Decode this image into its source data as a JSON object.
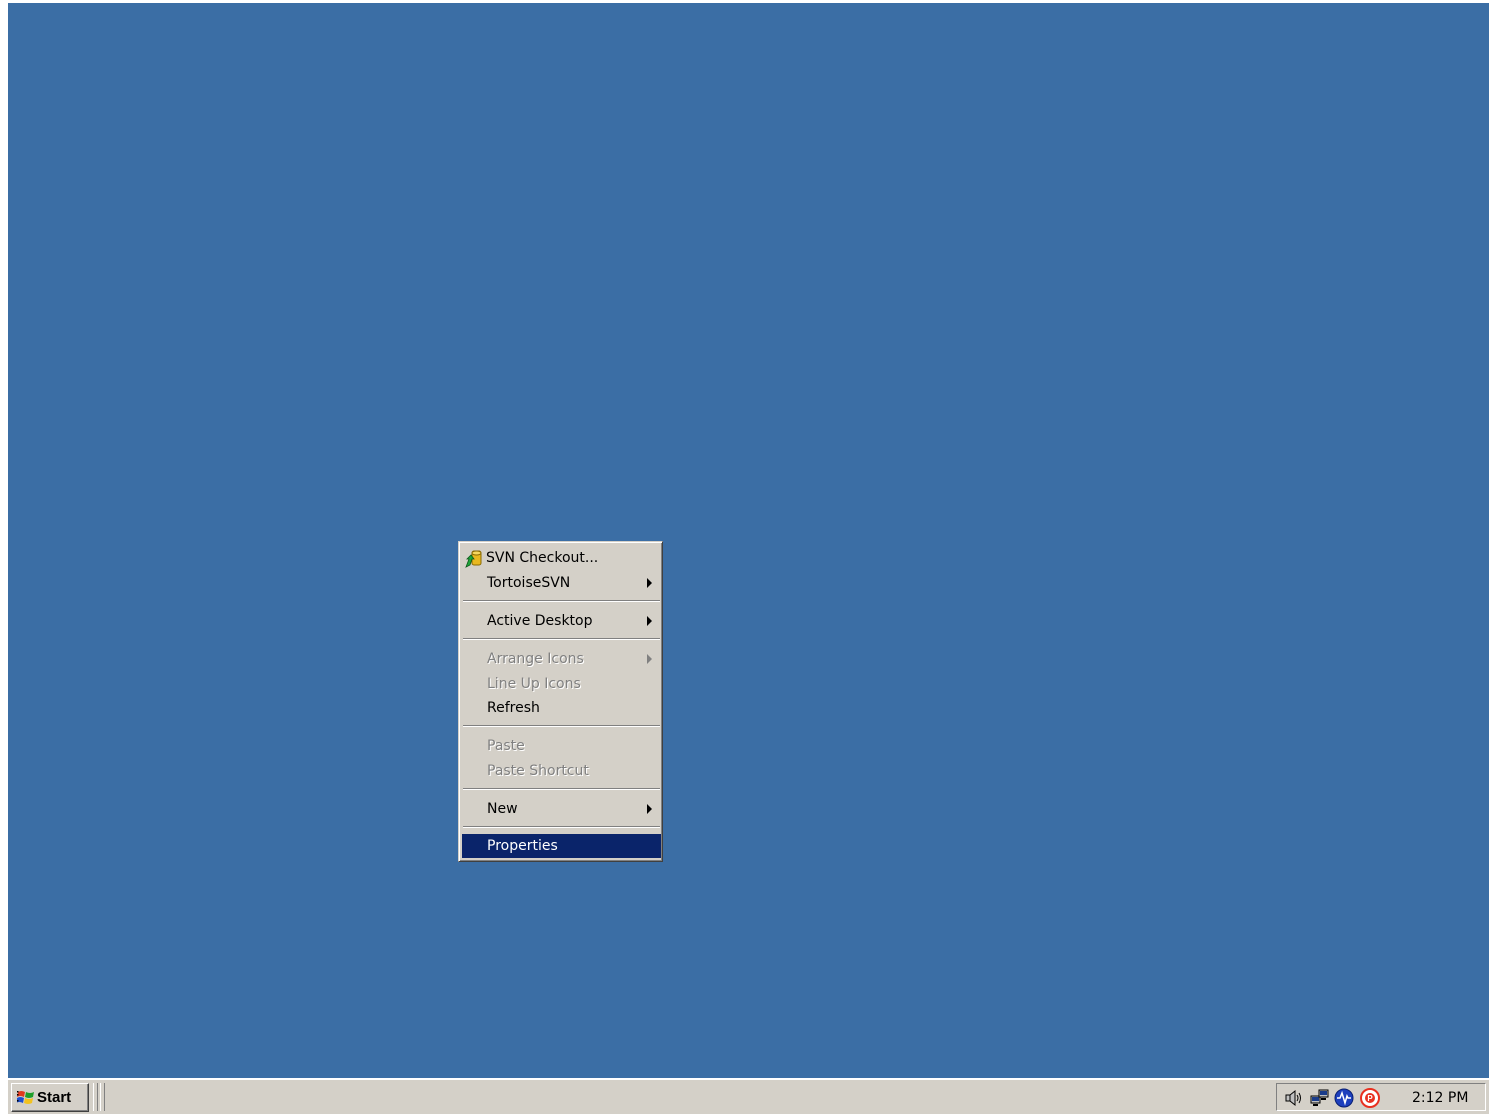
{
  "colors": {
    "desktop_background": "#3b6ea5",
    "menu_background": "#d4d0c8",
    "highlight": "#0a246a"
  },
  "context_menu": {
    "items": [
      {
        "label": "SVN Checkout...",
        "icon": "tortoisesvn-checkout-icon",
        "enabled": true
      },
      {
        "label": "TortoiseSVN",
        "submenu": true,
        "enabled": true
      },
      {
        "label": "Active Desktop",
        "submenu": true,
        "enabled": true
      },
      {
        "label": "Arrange Icons",
        "submenu": true,
        "enabled": false
      },
      {
        "label": "Line Up Icons",
        "enabled": false
      },
      {
        "label": "Refresh",
        "enabled": true
      },
      {
        "label": "Paste",
        "enabled": false
      },
      {
        "label": "Paste Shortcut",
        "enabled": false
      },
      {
        "label": "New",
        "submenu": true,
        "enabled": true
      },
      {
        "label": "Properties",
        "enabled": true,
        "highlighted": true
      }
    ]
  },
  "taskbar": {
    "start_label": "Start",
    "tray_icons": [
      "speaker-icon",
      "network-icon",
      "monitor-icon",
      "security-icon"
    ],
    "clock": "2:12 PM"
  }
}
